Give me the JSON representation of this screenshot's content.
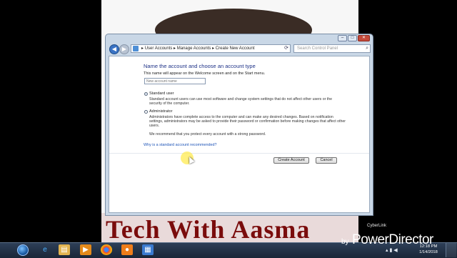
{
  "background": {
    "banner_text": "Tech With Aasma"
  },
  "window": {
    "breadcrumb": [
      "User Accounts",
      "Manage Accounts",
      "Create New Account"
    ],
    "breadcrumb_separator": "▸",
    "search_placeholder": "Search Control Panel",
    "heading": "Name the account and choose an account type",
    "subtitle": "This name will appear on the Welcome screen and on the Start menu.",
    "name_input_placeholder": "New account name",
    "options": [
      {
        "label": "Standard user",
        "selected": true,
        "description": "Standard account users can use most software and change system settings that do not affect other users or the security of the computer."
      },
      {
        "label": "Administrator",
        "selected": false,
        "description": "Administrators have complete access to the computer and can make any desired changes. Based on notification settings, administrators may be asked to provide their password or confirmation before making changes that affect other users."
      }
    ],
    "recommendation": "We recommend that you protect every account with a strong password.",
    "help_link": "Why is a standard account recommended?",
    "create_button": "Create Account",
    "cancel_button": "Cancel"
  },
  "watermark": {
    "small": "CyberLink",
    "by": "by",
    "brand": "PowerDirector"
  },
  "taskbar": {
    "time": "12:18 PM",
    "date": "1/14/2018",
    "pinned_icons": [
      "internet-explorer-icon",
      "file-explorer-icon",
      "media-player-icon",
      "chrome-icon",
      "avast-icon",
      "control-panel-icon"
    ]
  },
  "colors": {
    "heading": "#1e3287",
    "link": "#1f55b8",
    "taskbar": "#1f2d42"
  }
}
